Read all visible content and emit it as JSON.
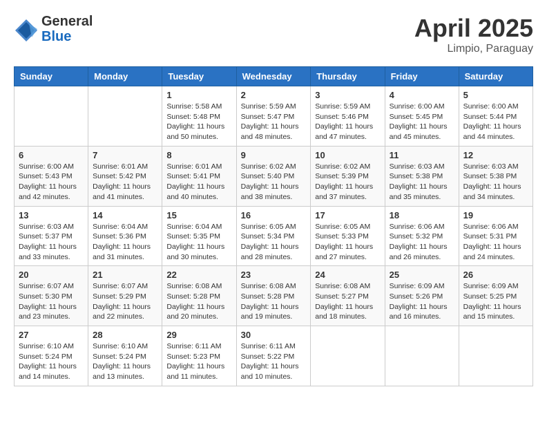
{
  "header": {
    "logo_general": "General",
    "logo_blue": "Blue",
    "month_title": "April 2025",
    "location": "Limpio, Paraguay"
  },
  "days_of_week": [
    "Sunday",
    "Monday",
    "Tuesday",
    "Wednesday",
    "Thursday",
    "Friday",
    "Saturday"
  ],
  "weeks": [
    [
      {
        "day": "",
        "info": ""
      },
      {
        "day": "",
        "info": ""
      },
      {
        "day": "1",
        "info": "Sunrise: 5:58 AM\nSunset: 5:48 PM\nDaylight: 11 hours and 50 minutes."
      },
      {
        "day": "2",
        "info": "Sunrise: 5:59 AM\nSunset: 5:47 PM\nDaylight: 11 hours and 48 minutes."
      },
      {
        "day": "3",
        "info": "Sunrise: 5:59 AM\nSunset: 5:46 PM\nDaylight: 11 hours and 47 minutes."
      },
      {
        "day": "4",
        "info": "Sunrise: 6:00 AM\nSunset: 5:45 PM\nDaylight: 11 hours and 45 minutes."
      },
      {
        "day": "5",
        "info": "Sunrise: 6:00 AM\nSunset: 5:44 PM\nDaylight: 11 hours and 44 minutes."
      }
    ],
    [
      {
        "day": "6",
        "info": "Sunrise: 6:00 AM\nSunset: 5:43 PM\nDaylight: 11 hours and 42 minutes."
      },
      {
        "day": "7",
        "info": "Sunrise: 6:01 AM\nSunset: 5:42 PM\nDaylight: 11 hours and 41 minutes."
      },
      {
        "day": "8",
        "info": "Sunrise: 6:01 AM\nSunset: 5:41 PM\nDaylight: 11 hours and 40 minutes."
      },
      {
        "day": "9",
        "info": "Sunrise: 6:02 AM\nSunset: 5:40 PM\nDaylight: 11 hours and 38 minutes."
      },
      {
        "day": "10",
        "info": "Sunrise: 6:02 AM\nSunset: 5:39 PM\nDaylight: 11 hours and 37 minutes."
      },
      {
        "day": "11",
        "info": "Sunrise: 6:03 AM\nSunset: 5:38 PM\nDaylight: 11 hours and 35 minutes."
      },
      {
        "day": "12",
        "info": "Sunrise: 6:03 AM\nSunset: 5:38 PM\nDaylight: 11 hours and 34 minutes."
      }
    ],
    [
      {
        "day": "13",
        "info": "Sunrise: 6:03 AM\nSunset: 5:37 PM\nDaylight: 11 hours and 33 minutes."
      },
      {
        "day": "14",
        "info": "Sunrise: 6:04 AM\nSunset: 5:36 PM\nDaylight: 11 hours and 31 minutes."
      },
      {
        "day": "15",
        "info": "Sunrise: 6:04 AM\nSunset: 5:35 PM\nDaylight: 11 hours and 30 minutes."
      },
      {
        "day": "16",
        "info": "Sunrise: 6:05 AM\nSunset: 5:34 PM\nDaylight: 11 hours and 28 minutes."
      },
      {
        "day": "17",
        "info": "Sunrise: 6:05 AM\nSunset: 5:33 PM\nDaylight: 11 hours and 27 minutes."
      },
      {
        "day": "18",
        "info": "Sunrise: 6:06 AM\nSunset: 5:32 PM\nDaylight: 11 hours and 26 minutes."
      },
      {
        "day": "19",
        "info": "Sunrise: 6:06 AM\nSunset: 5:31 PM\nDaylight: 11 hours and 24 minutes."
      }
    ],
    [
      {
        "day": "20",
        "info": "Sunrise: 6:07 AM\nSunset: 5:30 PM\nDaylight: 11 hours and 23 minutes."
      },
      {
        "day": "21",
        "info": "Sunrise: 6:07 AM\nSunset: 5:29 PM\nDaylight: 11 hours and 22 minutes."
      },
      {
        "day": "22",
        "info": "Sunrise: 6:08 AM\nSunset: 5:28 PM\nDaylight: 11 hours and 20 minutes."
      },
      {
        "day": "23",
        "info": "Sunrise: 6:08 AM\nSunset: 5:28 PM\nDaylight: 11 hours and 19 minutes."
      },
      {
        "day": "24",
        "info": "Sunrise: 6:08 AM\nSunset: 5:27 PM\nDaylight: 11 hours and 18 minutes."
      },
      {
        "day": "25",
        "info": "Sunrise: 6:09 AM\nSunset: 5:26 PM\nDaylight: 11 hours and 16 minutes."
      },
      {
        "day": "26",
        "info": "Sunrise: 6:09 AM\nSunset: 5:25 PM\nDaylight: 11 hours and 15 minutes."
      }
    ],
    [
      {
        "day": "27",
        "info": "Sunrise: 6:10 AM\nSunset: 5:24 PM\nDaylight: 11 hours and 14 minutes."
      },
      {
        "day": "28",
        "info": "Sunrise: 6:10 AM\nSunset: 5:24 PM\nDaylight: 11 hours and 13 minutes."
      },
      {
        "day": "29",
        "info": "Sunrise: 6:11 AM\nSunset: 5:23 PM\nDaylight: 11 hours and 11 minutes."
      },
      {
        "day": "30",
        "info": "Sunrise: 6:11 AM\nSunset: 5:22 PM\nDaylight: 11 hours and 10 minutes."
      },
      {
        "day": "",
        "info": ""
      },
      {
        "day": "",
        "info": ""
      },
      {
        "day": "",
        "info": ""
      }
    ]
  ]
}
